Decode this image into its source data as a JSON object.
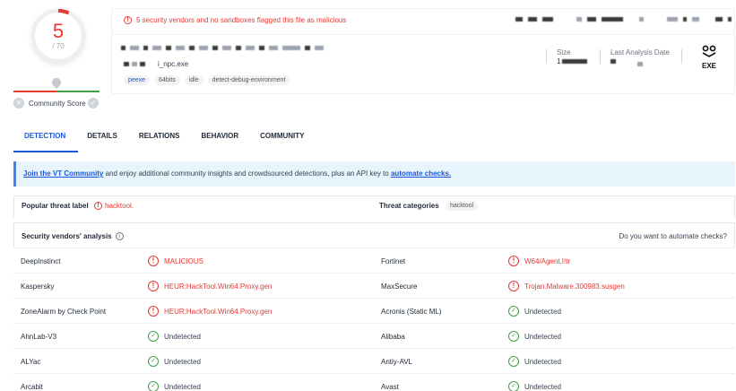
{
  "score": {
    "detected": "5",
    "total": "/ 70",
    "community_label": "Community Score"
  },
  "header": {
    "alert": "5 security vendors and no sandboxes flagged this file as malicious",
    "filename": "i_npc.exe",
    "tags": [
      "peexe",
      "64bits",
      "idle",
      "detect-debug-environment"
    ],
    "size_label": "Size",
    "size_value": "1",
    "last_analysis_label": "Last Analysis Date",
    "file_type": "EXE"
  },
  "tabs": [
    "DETECTION",
    "DETAILS",
    "RELATIONS",
    "BEHAVIOR",
    "COMMUNITY"
  ],
  "banner": {
    "link1": "Join the VT Community",
    "text": " and enjoy additional community insights and crowdsourced detections, plus an API key to ",
    "link2": "automate checks."
  },
  "threat": {
    "popular_label": "Popular threat label",
    "popular_value": "hacktool.",
    "categories_label": "Threat categories",
    "categories_value": "hacktool"
  },
  "vendors": {
    "title": "Security vendors' analysis",
    "automate": "Do you want to automate checks?"
  },
  "rows": [
    {
      "l_name": "DeepInstinct",
      "l_result": "MALICIOUS",
      "l_mal": true,
      "r_name": "Fortinet",
      "r_result": "W64/Agent.I!tr",
      "r_mal": true
    },
    {
      "l_name": "Kaspersky",
      "l_result": "HEUR:HackTool.Win64.Proxy.gen",
      "l_mal": true,
      "r_name": "MaxSecure",
      "r_result": "Trojan.Malware.300983.susgen",
      "r_mal": true
    },
    {
      "l_name": "ZoneAlarm by Check Point",
      "l_result": "HEUR:HackTool.Win64.Proxy.gen",
      "l_mal": true,
      "r_name": "Acronis (Static ML)",
      "r_result": "Undetected",
      "r_mal": false
    },
    {
      "l_name": "AhnLab-V3",
      "l_result": "Undetected",
      "l_mal": false,
      "r_name": "Alibaba",
      "r_result": "Undetected",
      "r_mal": false
    },
    {
      "l_name": "ALYac",
      "l_result": "Undetected",
      "l_mal": false,
      "r_name": "Antiy-AVL",
      "r_result": "Undetected",
      "r_mal": false
    },
    {
      "l_name": "Arcabit",
      "l_result": "Undetected",
      "l_mal": false,
      "r_name": "Avast",
      "r_result": "Undetected",
      "r_mal": false
    }
  ],
  "colors": {
    "malicious": "#e53935",
    "clean": "#43a047",
    "accent": "#1a56db"
  }
}
